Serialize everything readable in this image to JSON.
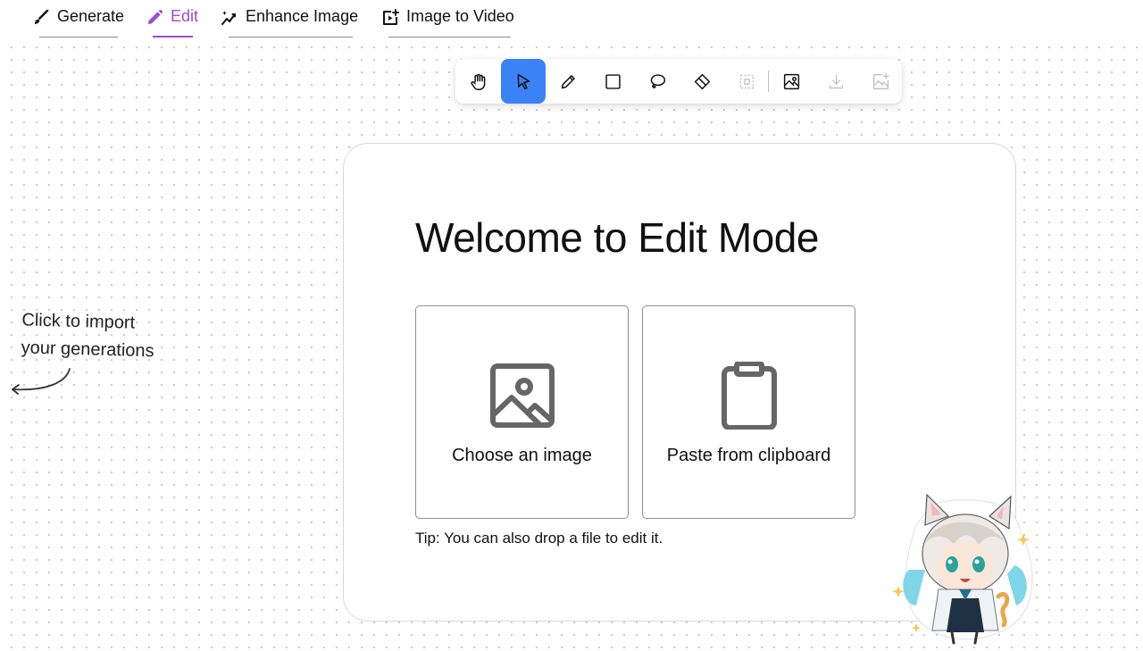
{
  "nav": {
    "tabs": [
      {
        "label": "Generate",
        "icon": "brush-icon"
      },
      {
        "label": "Edit",
        "icon": "pencil-icon",
        "active": true
      },
      {
        "label": "Enhance Image",
        "icon": "sparkle-chart-icon"
      },
      {
        "label": "Image to Video",
        "icon": "video-plus-icon"
      }
    ]
  },
  "toolbar": {
    "tools": [
      {
        "name": "hand-tool",
        "icon": "hand-icon"
      },
      {
        "name": "select-tool",
        "icon": "cursor-icon",
        "selected": true
      },
      {
        "name": "pencil-tool",
        "icon": "pencil-icon"
      },
      {
        "name": "rectangle-tool",
        "icon": "square-icon"
      },
      {
        "name": "lasso-tool",
        "icon": "lasso-icon"
      },
      {
        "name": "eraser-tool",
        "icon": "eraser-icon"
      },
      {
        "name": "crop-tool",
        "icon": "crop-dashed-icon",
        "disabled": true
      },
      {
        "name": "image-tool",
        "icon": "image-icon"
      },
      {
        "name": "download-tool",
        "icon": "download-icon",
        "disabled": true
      },
      {
        "name": "add-image-tool",
        "icon": "image-plus-icon",
        "disabled": true
      }
    ]
  },
  "main": {
    "title": "Welcome to Edit Mode",
    "choose_label": "Choose an image",
    "paste_label": "Paste from clipboard",
    "tip": "Tip: You can also drop a file to edit it."
  },
  "hint": {
    "line1": "Click to import",
    "line2": "your generations"
  },
  "colors": {
    "accent": "#9b4bdb",
    "tool_selected": "#3b82f6"
  }
}
